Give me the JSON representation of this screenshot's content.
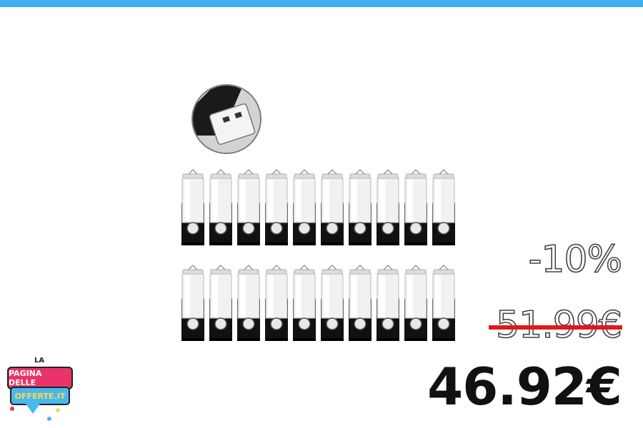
{
  "discount_label": "-10%",
  "old_price": "51.99€",
  "new_price": "46.92€",
  "logo": {
    "top_word": "LA",
    "line1": "PAGINA DELLE",
    "line2": "OFFERTE.IT"
  },
  "product": {
    "stick_count_per_row": 10,
    "rows": 2
  },
  "colors": {
    "top_bar": "#3db1f2",
    "strike": "#e0191f",
    "logo_pink": "#e8346a",
    "logo_blue": "#49b8ec"
  }
}
